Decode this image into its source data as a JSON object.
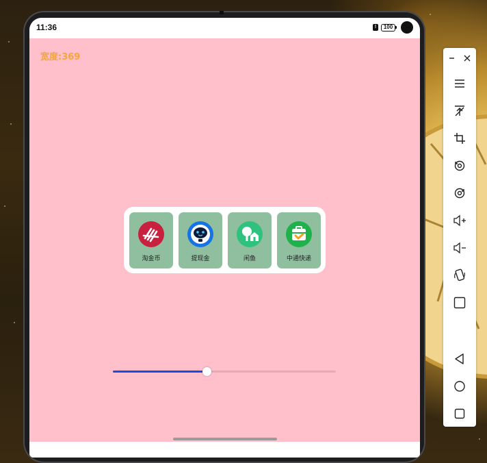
{
  "status_bar": {
    "time": "11:36",
    "battery": "100"
  },
  "app": {
    "width_label": "宽度:369",
    "background_color": "#ffc0cb",
    "label_color": "#f4a63a",
    "tiles": [
      {
        "label": "淘金币",
        "icon": "taojinbi-app-icon"
      },
      {
        "label": "提现金",
        "icon": "tixianjin-app-icon"
      },
      {
        "label": "闲鱼",
        "icon": "xianyu-app-icon"
      },
      {
        "label": "中通快递",
        "icon": "zhongtong-app-icon"
      }
    ],
    "slider": {
      "value_fraction": 0.42,
      "fill_color": "#1a4be0"
    }
  },
  "emulator_toolbar": {
    "items": [
      "minimize-icon",
      "close-icon",
      "menu-icon",
      "pin-top-icon",
      "crop-icon",
      "rotate-left-icon",
      "rotate-right-icon",
      "volume-up-icon",
      "volume-down-icon",
      "shake-icon",
      "screenshot-square-icon",
      "back-icon",
      "home-icon",
      "recents-icon"
    ]
  }
}
